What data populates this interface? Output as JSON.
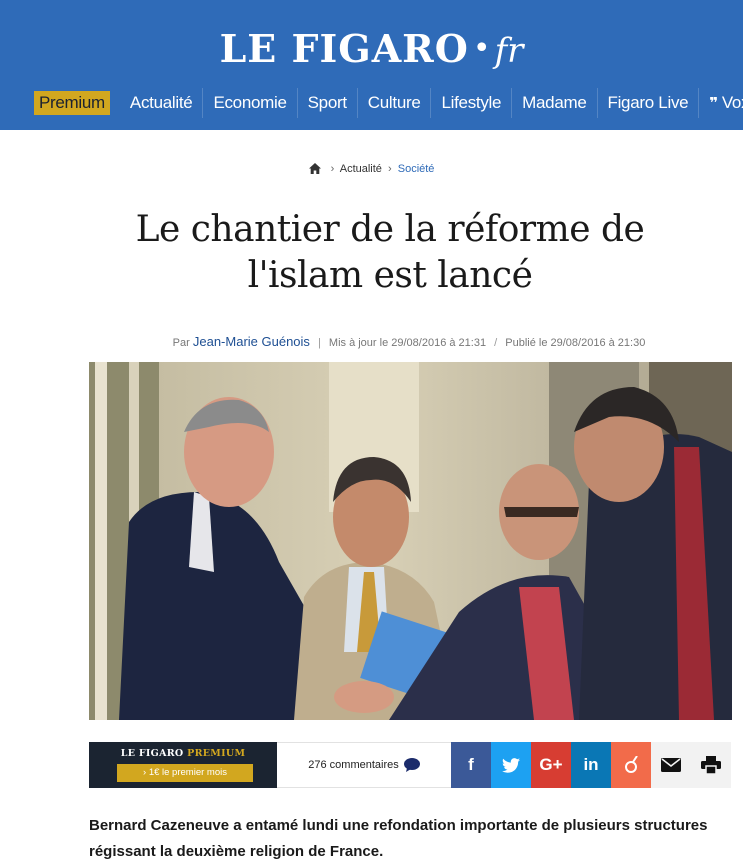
{
  "header": {
    "logo_main": "LE FIGARO",
    "logo_dot": "•",
    "logo_fr": "fr",
    "nav": [
      {
        "label": "Premium"
      },
      {
        "label": "Actualité"
      },
      {
        "label": "Economie"
      },
      {
        "label": "Sport"
      },
      {
        "label": "Culture"
      },
      {
        "label": "Lifestyle"
      },
      {
        "label": "Madame"
      },
      {
        "label": "Figaro Live"
      },
      {
        "label": "Vox"
      }
    ]
  },
  "breadcrumb": {
    "items": [
      "Actualité",
      "Société"
    ]
  },
  "article": {
    "title": "Le chantier de la réforme de l'islam est lancé",
    "byline_prefix": "Par",
    "author": "Jean-Marie Guénois",
    "updated": "Mis à jour le 29/08/2016 à 21:31",
    "published": "Publié le 29/08/2016 à 21:30",
    "lead": "Bernard Cazeneuve a entamé lundi une refondation importante de plusieurs structures régissant la deuxième religion de France."
  },
  "promo": {
    "brand_a": "LE FIGARO",
    "brand_b": "PREMIUM",
    "cta": "› 1€ le premier mois"
  },
  "social": {
    "comments": "276 commentaires",
    "facebook": "f",
    "google": "G+",
    "linkedin": "in"
  },
  "colors": {
    "header_bg": "#2f6bb8",
    "premium_gold": "#d2a71f",
    "facebook": "#3b5998",
    "twitter": "#1da1f2",
    "google": "#d73d32",
    "linkedin": "#0a77b5",
    "viadeo": "#f26b4a"
  }
}
